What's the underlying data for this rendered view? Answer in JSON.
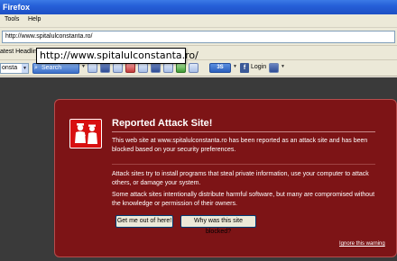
{
  "window": {
    "title": "Firefox"
  },
  "menu": {
    "items": [
      {
        "label": "Tools"
      },
      {
        "label": "Help"
      }
    ]
  },
  "address_bar": {
    "url": "http://www.spitalulconstanta.ro/"
  },
  "bookmarks": {
    "latest_label": "atest Headline"
  },
  "toolbar": {
    "combo_value": "onsta",
    "search_label": "Search",
    "button_3s": "3S",
    "login_label": "Login",
    "facebook_glyph": "f"
  },
  "tooltip": {
    "text": "http://www.spitalulconstanta.ro/"
  },
  "warning": {
    "title": "Reported Attack Site!",
    "paragraph1": "This web site at www.spitalulconstanta.ro has been reported as an attack site and has been blocked based on your security preferences.",
    "paragraph2": "Attack sites try to install programs that steal private information, use your computer to attack others, or damage your system.",
    "paragraph3": "Some attack sites intentionally distribute harmful software, but many are compromised without the knowledge or permission of their owners.",
    "button_get_out": "Get me out of here!",
    "button_why": "Why was this site blocked?",
    "ignore_link": "Ignore this warning"
  },
  "colors": {
    "panel_background": "#7d1416",
    "icon_red": "#d80f10"
  },
  "icons": [
    "police-officer-icon",
    "search-icon",
    "facebook-icon"
  ]
}
